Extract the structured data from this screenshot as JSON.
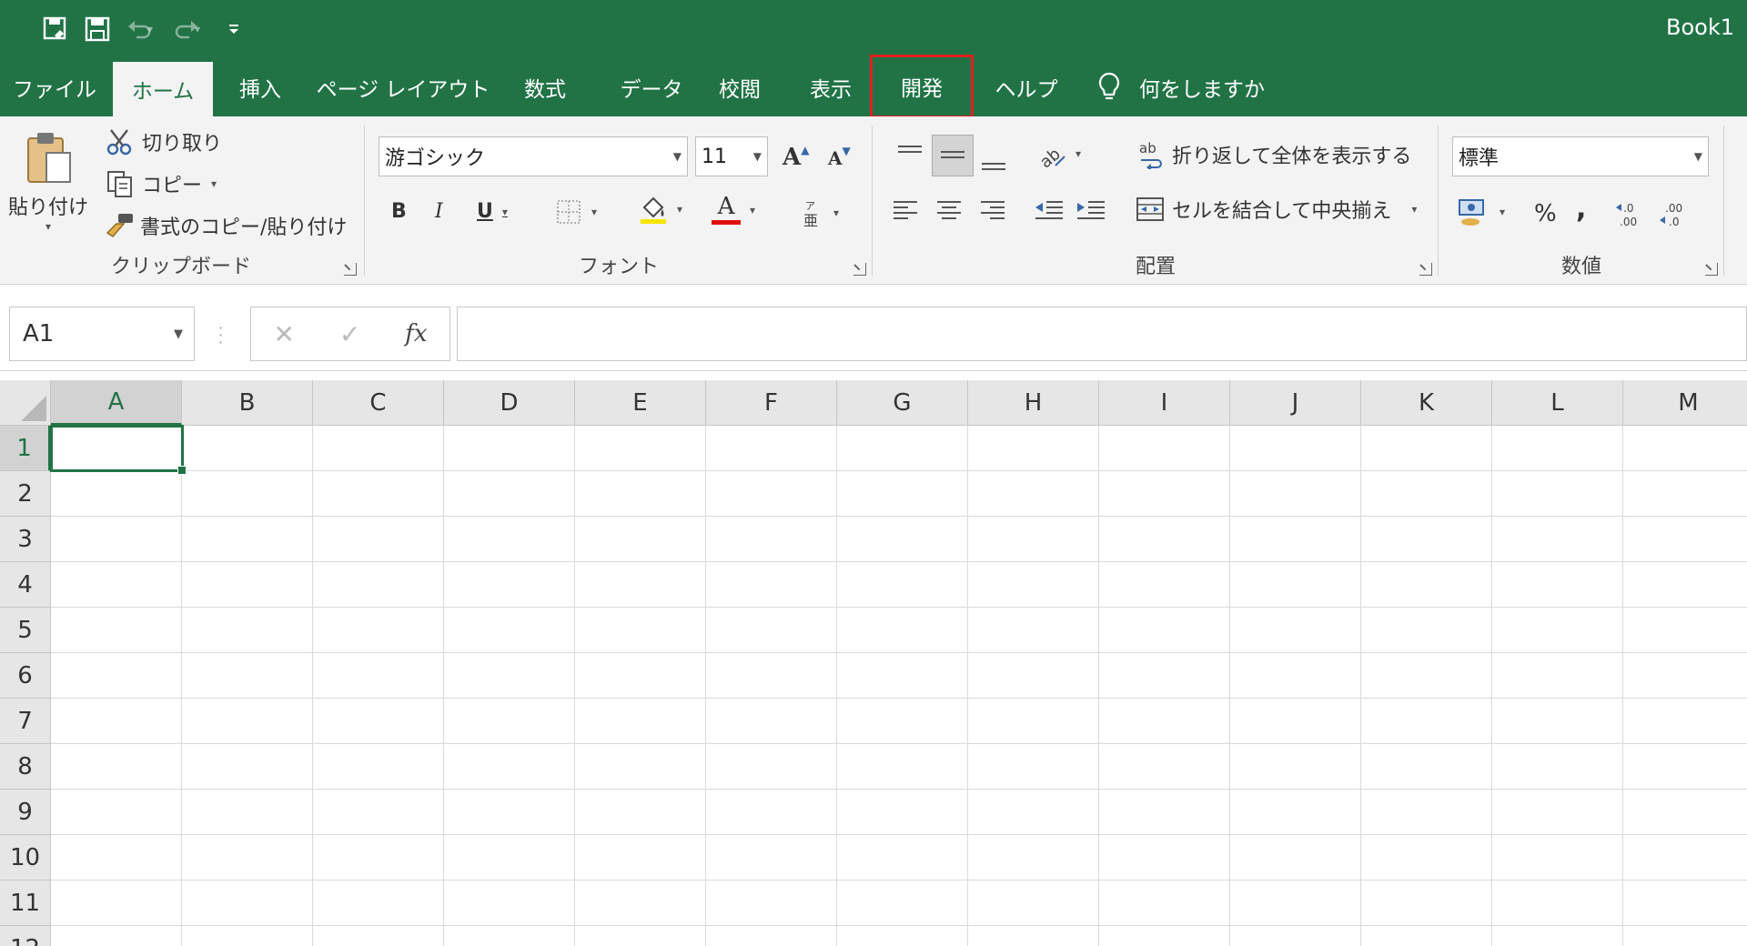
{
  "window": {
    "title": "Book1"
  },
  "qat": {
    "items": [
      "autosave-icon",
      "save-icon",
      "undo-icon",
      "redo-icon",
      "customize-qat-icon"
    ]
  },
  "tabs": [
    {
      "label": "ファイル",
      "state": "normal"
    },
    {
      "label": "ホーム",
      "state": "active"
    },
    {
      "label": "挿入",
      "state": "normal"
    },
    {
      "label": "ページ レイアウト",
      "state": "normal"
    },
    {
      "label": "数式",
      "state": "normal"
    },
    {
      "label": "データ",
      "state": "normal"
    },
    {
      "label": "校閲",
      "state": "normal"
    },
    {
      "label": "表示",
      "state": "normal"
    },
    {
      "label": "開発",
      "state": "highlighted"
    },
    {
      "label": "ヘルプ",
      "state": "normal"
    }
  ],
  "tell_me": {
    "label": "何をしますか"
  },
  "ribbon": {
    "clipboard": {
      "label": "クリップボード",
      "paste": "貼り付け",
      "cut": "切り取り",
      "copy": "コピー",
      "format_painter": "書式のコピー/貼り付け"
    },
    "font": {
      "label": "フォント",
      "font_name": "游ゴシック",
      "font_size": "11",
      "bold": "B",
      "italic": "I",
      "underline": "U",
      "grow": "A",
      "shrink": "A",
      "color_letter": "A"
    },
    "alignment": {
      "label": "配置",
      "wrap_text": "折り返して全体を表示する",
      "merge_center": "セルを結合して中央揃え"
    },
    "number": {
      "label": "数値",
      "format": "標準",
      "percent": "%",
      "comma": ","
    }
  },
  "formula_bar": {
    "name_box": "A1",
    "fx": "fx",
    "value": ""
  },
  "grid": {
    "columns": [
      "A",
      "B",
      "C",
      "D",
      "E",
      "F",
      "G",
      "H",
      "I",
      "J",
      "K",
      "L",
      "M"
    ],
    "rows": [
      "1",
      "2",
      "3",
      "4",
      "5",
      "6",
      "7",
      "8",
      "9",
      "10",
      "11",
      "12"
    ],
    "active_cell": "A1"
  },
  "colors": {
    "accent": "#217346",
    "highlight": "#e02020",
    "ribbon_bg": "#f3f3f3"
  }
}
